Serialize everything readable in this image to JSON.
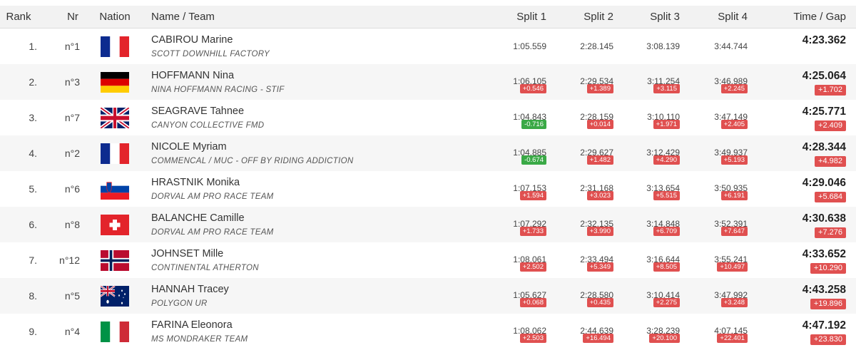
{
  "header": {
    "rank": "Rank",
    "nr": "Nr",
    "nation": "Nation",
    "name_team": "Name / Team",
    "split1": "Split 1",
    "split2": "Split 2",
    "split3": "Split 3",
    "split4": "Split 4",
    "time_gap": "Time / Gap"
  },
  "colors": {
    "gap_slower": "#e05050",
    "gap_faster": "#3aa946",
    "row_alt": "#f6f6f6"
  },
  "rows": [
    {
      "rank": "1.",
      "nr": "n°1",
      "flag": "france-flag-icon",
      "name": "CABIROU Marine",
      "team": "SCOTT DOWNHILL FACTORY",
      "splits": [
        {
          "time": "1:05.559",
          "gap": "",
          "gap_type": "none"
        },
        {
          "time": "2:28.145",
          "gap": "",
          "gap_type": "none"
        },
        {
          "time": "3:08.139",
          "gap": "",
          "gap_type": "none"
        },
        {
          "time": "3:44.744",
          "gap": "",
          "gap_type": "none"
        }
      ],
      "time": "4:23.362",
      "time_gap": ""
    },
    {
      "rank": "2.",
      "nr": "n°3",
      "flag": "germany-flag-icon",
      "name": "HOFFMANN Nina",
      "team": "NINA HOFFMANN RACING - STIF",
      "splits": [
        {
          "time": "1:06.105",
          "gap": "+0.546",
          "gap_type": "red"
        },
        {
          "time": "2:29.534",
          "gap": "+1.389",
          "gap_type": "red"
        },
        {
          "time": "3:11.254",
          "gap": "+3.115",
          "gap_type": "red"
        },
        {
          "time": "3:46.989",
          "gap": "+2.245",
          "gap_type": "red"
        }
      ],
      "time": "4:25.064",
      "time_gap": "+1.702"
    },
    {
      "rank": "3.",
      "nr": "n°7",
      "flag": "uk-flag-icon",
      "name": "SEAGRAVE Tahnee",
      "team": "CANYON COLLECTIVE FMD",
      "splits": [
        {
          "time": "1:04.843",
          "gap": "-0.716",
          "gap_type": "green"
        },
        {
          "time": "2:28.159",
          "gap": "+0.014",
          "gap_type": "red"
        },
        {
          "time": "3:10.110",
          "gap": "+1.971",
          "gap_type": "red"
        },
        {
          "time": "3:47.149",
          "gap": "+2.405",
          "gap_type": "red"
        }
      ],
      "time": "4:25.771",
      "time_gap": "+2.409"
    },
    {
      "rank": "4.",
      "nr": "n°2",
      "flag": "france-flag-icon",
      "name": "NICOLE Myriam",
      "team": "COMMENCAL / MUC - OFF BY RIDING ADDICTION",
      "splits": [
        {
          "time": "1:04.885",
          "gap": "-0.674",
          "gap_type": "green"
        },
        {
          "time": "2:29.627",
          "gap": "+1.482",
          "gap_type": "red"
        },
        {
          "time": "3:12.429",
          "gap": "+4.290",
          "gap_type": "red"
        },
        {
          "time": "3:49.937",
          "gap": "+5.193",
          "gap_type": "red"
        }
      ],
      "time": "4:28.344",
      "time_gap": "+4.982"
    },
    {
      "rank": "5.",
      "nr": "n°6",
      "flag": "slovenia-flag-icon",
      "name": "HRASTNIK Monika",
      "team": "DORVAL AM PRO RACE TEAM",
      "splits": [
        {
          "time": "1:07.153",
          "gap": "+1.594",
          "gap_type": "red"
        },
        {
          "time": "2:31.168",
          "gap": "+3.023",
          "gap_type": "red"
        },
        {
          "time": "3:13.654",
          "gap": "+5.515",
          "gap_type": "red"
        },
        {
          "time": "3:50.935",
          "gap": "+6.191",
          "gap_type": "red"
        }
      ],
      "time": "4:29.046",
      "time_gap": "+5.684"
    },
    {
      "rank": "6.",
      "nr": "n°8",
      "flag": "switzerland-flag-icon",
      "name": "BALANCHE Camille",
      "team": "DORVAL AM PRO RACE TEAM",
      "splits": [
        {
          "time": "1:07.292",
          "gap": "+1.733",
          "gap_type": "red"
        },
        {
          "time": "2:32.135",
          "gap": "+3.990",
          "gap_type": "red"
        },
        {
          "time": "3:14.848",
          "gap": "+6.709",
          "gap_type": "red"
        },
        {
          "time": "3:52.391",
          "gap": "+7.647",
          "gap_type": "red"
        }
      ],
      "time": "4:30.638",
      "time_gap": "+7.276"
    },
    {
      "rank": "7.",
      "nr": "n°12",
      "flag": "norway-flag-icon",
      "name": "JOHNSET Mille",
      "team": "CONTINENTAL ATHERTON",
      "splits": [
        {
          "time": "1:08.061",
          "gap": "+2.502",
          "gap_type": "red"
        },
        {
          "time": "2:33.494",
          "gap": "+5.349",
          "gap_type": "red"
        },
        {
          "time": "3:16.644",
          "gap": "+8.505",
          "gap_type": "red"
        },
        {
          "time": "3:55.241",
          "gap": "+10.497",
          "gap_type": "red"
        }
      ],
      "time": "4:33.652",
      "time_gap": "+10.290"
    },
    {
      "rank": "8.",
      "nr": "n°5",
      "flag": "australia-flag-icon",
      "name": "HANNAH Tracey",
      "team": "POLYGON UR",
      "splits": [
        {
          "time": "1:05.627",
          "gap": "+0.068",
          "gap_type": "red"
        },
        {
          "time": "2:28.580",
          "gap": "+0.435",
          "gap_type": "red"
        },
        {
          "time": "3:10.414",
          "gap": "+2.275",
          "gap_type": "red"
        },
        {
          "time": "3:47.992",
          "gap": "+3.248",
          "gap_type": "red"
        }
      ],
      "time": "4:43.258",
      "time_gap": "+19.896"
    },
    {
      "rank": "9.",
      "nr": "n°4",
      "flag": "italy-flag-icon",
      "name": "FARINA Eleonora",
      "team": "MS MONDRAKER TEAM",
      "splits": [
        {
          "time": "1:08.062",
          "gap": "+2.503",
          "gap_type": "red"
        },
        {
          "time": "2:44.639",
          "gap": "+16.494",
          "gap_type": "red"
        },
        {
          "time": "3:28.239",
          "gap": "+20.100",
          "gap_type": "red"
        },
        {
          "time": "4:07.145",
          "gap": "+22.401",
          "gap_type": "red"
        }
      ],
      "time": "4:47.192",
      "time_gap": "+23.830"
    }
  ]
}
